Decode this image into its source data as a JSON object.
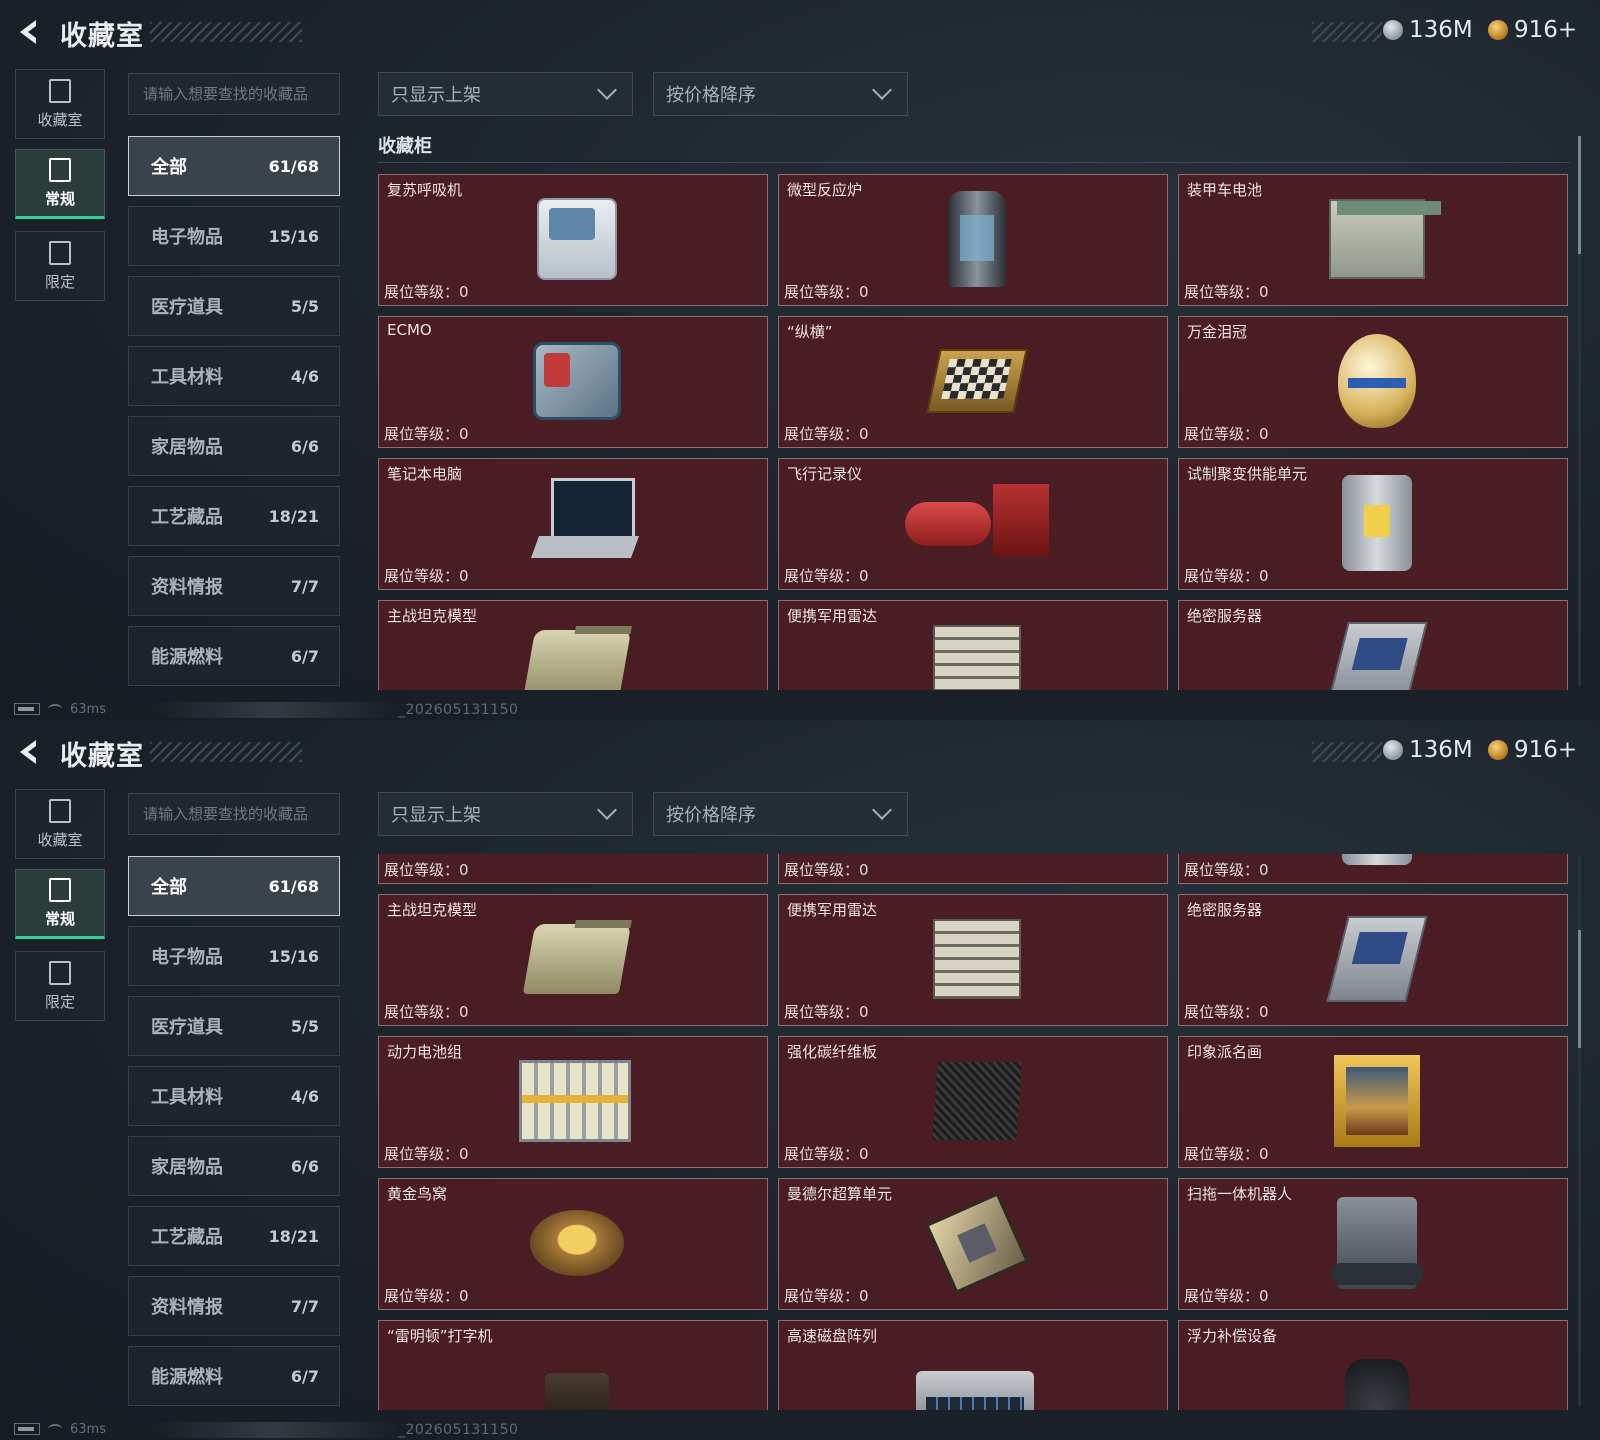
{
  "header": {
    "title": "收藏室",
    "currency_silver": "136M",
    "currency_gold": "916+"
  },
  "rail": {
    "collection": "收藏室",
    "regular": "常规",
    "limited": "限定"
  },
  "search": {
    "placeholder": "请输入想要查找的收藏品"
  },
  "filters": {
    "listed_only": "只显示上架",
    "sort": "按价格降序"
  },
  "categories": [
    {
      "label": "全部",
      "count": "61/68"
    },
    {
      "label": "电子物品",
      "count": "15/16"
    },
    {
      "label": "医疗道具",
      "count": "5/5"
    },
    {
      "label": "工具材料",
      "count": "4/6"
    },
    {
      "label": "家居物品",
      "count": "6/6"
    },
    {
      "label": "工艺藏品",
      "count": "18/21"
    },
    {
      "label": "资料情报",
      "count": "7/7"
    },
    {
      "label": "能源燃料",
      "count": "6/7"
    }
  ],
  "section_title": "收藏柜",
  "level_label": "展位等级：0",
  "items": [
    {
      "name": "复苏呼吸机",
      "icon": "respirator-icon"
    },
    {
      "name": "微型反应炉",
      "icon": "micro-reactor-icon"
    },
    {
      "name": "装甲车电池",
      "icon": "armored-battery-icon"
    },
    {
      "name": "ECMO",
      "icon": "ecmo-icon"
    },
    {
      "name": "“纵横”",
      "icon": "chess-box-icon"
    },
    {
      "name": "万金泪冠",
      "icon": "jeweled-egg-icon"
    },
    {
      "name": "笔记本电脑",
      "icon": "laptop-icon"
    },
    {
      "name": "飞行记录仪",
      "icon": "flight-recorder-icon"
    },
    {
      "name": "试制聚变供能单元",
      "icon": "fusion-unit-icon"
    },
    {
      "name": "主战坦克模型",
      "icon": "tank-model-icon"
    },
    {
      "name": "便携军用雷达",
      "icon": "portable-radar-icon"
    },
    {
      "name": "绝密服务器",
      "icon": "server-icon"
    },
    {
      "name": "动力电池组",
      "icon": "power-battery-icon"
    },
    {
      "name": "强化碳纤维板",
      "icon": "carbon-plate-icon"
    },
    {
      "name": "印象派名画",
      "icon": "painting-icon"
    },
    {
      "name": "黄金鸟窝",
      "icon": "golden-nest-icon"
    },
    {
      "name": "曼德尔超算单元",
      "icon": "supercomputer-chip-icon"
    },
    {
      "name": "扫拖一体机器人",
      "icon": "mop-robot-icon"
    },
    {
      "name": "“雷明顿”打字机",
      "icon": "typewriter-icon"
    },
    {
      "name": "高速磁盘阵列",
      "icon": "disk-array-icon"
    },
    {
      "name": "浮力补偿设备",
      "icon": "buoyancy-device-icon"
    }
  ],
  "status": {
    "ping": "63ms",
    "build": "_202605131150"
  },
  "colors": {
    "card_bg": "#4a1c24",
    "accent_green": "#2fd39a"
  }
}
